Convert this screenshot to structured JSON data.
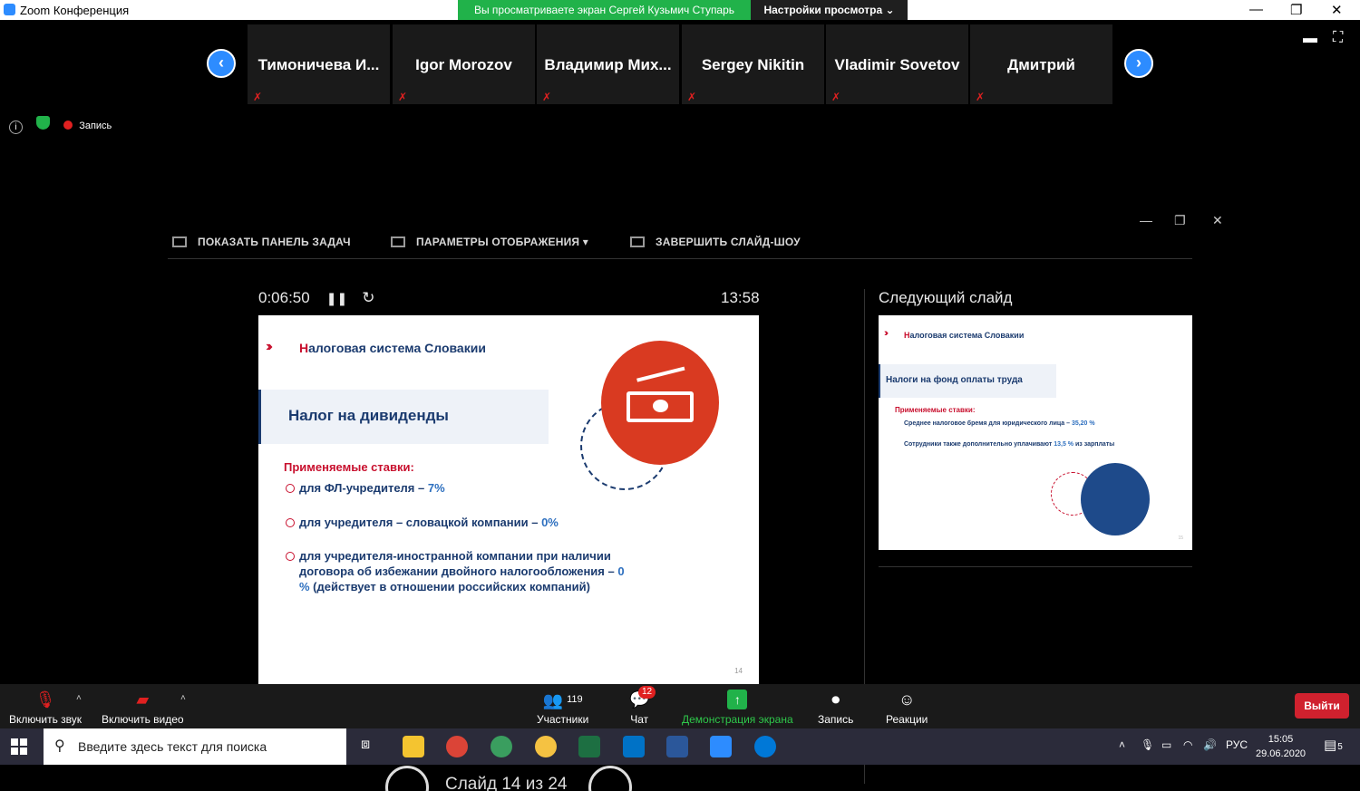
{
  "window": {
    "title": "Zoom Конференция"
  },
  "banner": {
    "text": "Вы просматриваете экран Сергей Кузьмич Ступарь",
    "view_options": "Настройки просмотра ⌄"
  },
  "participants": [
    "Тимоничева И...",
    "Igor Morozov",
    "Владимир Мих...",
    "Sergey Nikitin",
    "Vladimir Sovetov",
    "Дмитрий"
  ],
  "status": {
    "record_label": "Запись"
  },
  "presenter": {
    "show_taskbar": "ПОКАЗАТЬ ПАНЕЛЬ ЗАДАЧ",
    "display_settings": "ПАРАМЕТРЫ ОТОБРАЖЕНИЯ ▾",
    "end_slideshow": "ЗАВЕРШИТЬ СЛАЙД-ШОУ",
    "elapsed": "0:06:50",
    "clock": "13:58",
    "next_label": "Следующий слайд",
    "slide_counter": "Слайд 14 из 24"
  },
  "slide": {
    "title_first": "Н",
    "title_rest": "алоговая система Словакии",
    "box": "Налог на дивиденды",
    "subtitle": "Применяемые ставки:",
    "items": [
      {
        "text": "для ФЛ-учредителя – ",
        "value": "7%"
      },
      {
        "text": "для учредителя – словацкой компании – ",
        "value": "0%"
      },
      {
        "text": "для учредителя-иностранной компании при наличии договора об избежании двойного налогообложения – ",
        "value": "0 %",
        "tail": " (действует в отношении российских компаний)"
      }
    ],
    "page_num": "14"
  },
  "next_slide": {
    "title_first": "Н",
    "title_rest": "алоговая система Словакии",
    "box": "Налоги на фонд оплаты труда",
    "subtitle": "Применяемые ставки:",
    "item1": "Среднее налоговое бремя для юридического лица – ",
    "item1_value": "35,20 %",
    "item2": "Сотрудники также дополнительно уплачивают ",
    "item2_value": "13,5 %",
    "item2_tail": " из зарплаты",
    "page_num": "15"
  },
  "toolbar": {
    "mute": "Включить звук",
    "video": "Включить видео",
    "participants": "Участники",
    "participants_count": "119",
    "chat": "Чат",
    "chat_badge": "12",
    "share": "Демонстрация экрана",
    "record": "Запись",
    "reactions": "Реакции",
    "leave": "Выйти"
  },
  "taskbar": {
    "search_placeholder": "Введите здесь текст для поиска",
    "lang": "РУС",
    "time": "15:05",
    "date": "29.06.2020",
    "notif_count": "5"
  },
  "colors": {
    "accent": "#2d8cff",
    "green": "#21b24a",
    "brand_red": "#c8102e",
    "brand_blue": "#1b3b6f",
    "leave": "#d0212e"
  }
}
